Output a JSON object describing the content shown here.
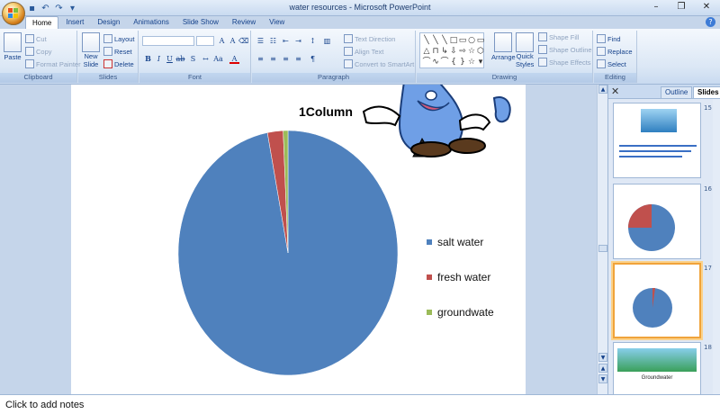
{
  "window": {
    "title": "water resources - Microsoft PowerPoint"
  },
  "tabs": [
    "Home",
    "Insert",
    "Design",
    "Animations",
    "Slide Show",
    "Review",
    "View"
  ],
  "ribbon": {
    "clipboard": {
      "label": "Clipboard",
      "paste": "Paste",
      "cut": "Cut",
      "copy": "Copy",
      "format_painter": "Format Painter"
    },
    "slides": {
      "label": "Slides",
      "new_slide_1": "New",
      "new_slide_2": "Slide",
      "layout": "Layout",
      "reset": "Reset",
      "delete": "Delete"
    },
    "font": {
      "label": "Font"
    },
    "paragraph": {
      "label": "Paragraph",
      "text_direction": "Text Direction",
      "align_text": "Align Text",
      "convert": "Convert to SmartArt"
    },
    "drawing": {
      "label": "Drawing",
      "arrange": "Arrange",
      "quick_styles_1": "Quick",
      "quick_styles_2": "Styles",
      "shape_fill": "Shape Fill",
      "shape_outline": "Shape Outline",
      "shape_effects": "Shape Effects"
    },
    "editing": {
      "label": "Editing",
      "find": "Find",
      "replace": "Replace",
      "select": "Select"
    }
  },
  "slide": {
    "title": "1Column"
  },
  "chart_data": {
    "type": "pie",
    "categories": [
      "salt water",
      "fresh water",
      "groundwate"
    ],
    "values": [
      97,
      2.3,
      0.7
    ],
    "colors": [
      "#4f81bd",
      "#c0504d",
      "#9bbb59"
    ],
    "legend_position": "right"
  },
  "pane": {
    "tab_outline": "Outline",
    "tab_slides": "Slides",
    "slide_numbers": [
      "15",
      "16",
      "17",
      "18"
    ],
    "thumb_groundwater": "Groundwater"
  },
  "notes": {
    "placeholder": "Click to add notes"
  }
}
